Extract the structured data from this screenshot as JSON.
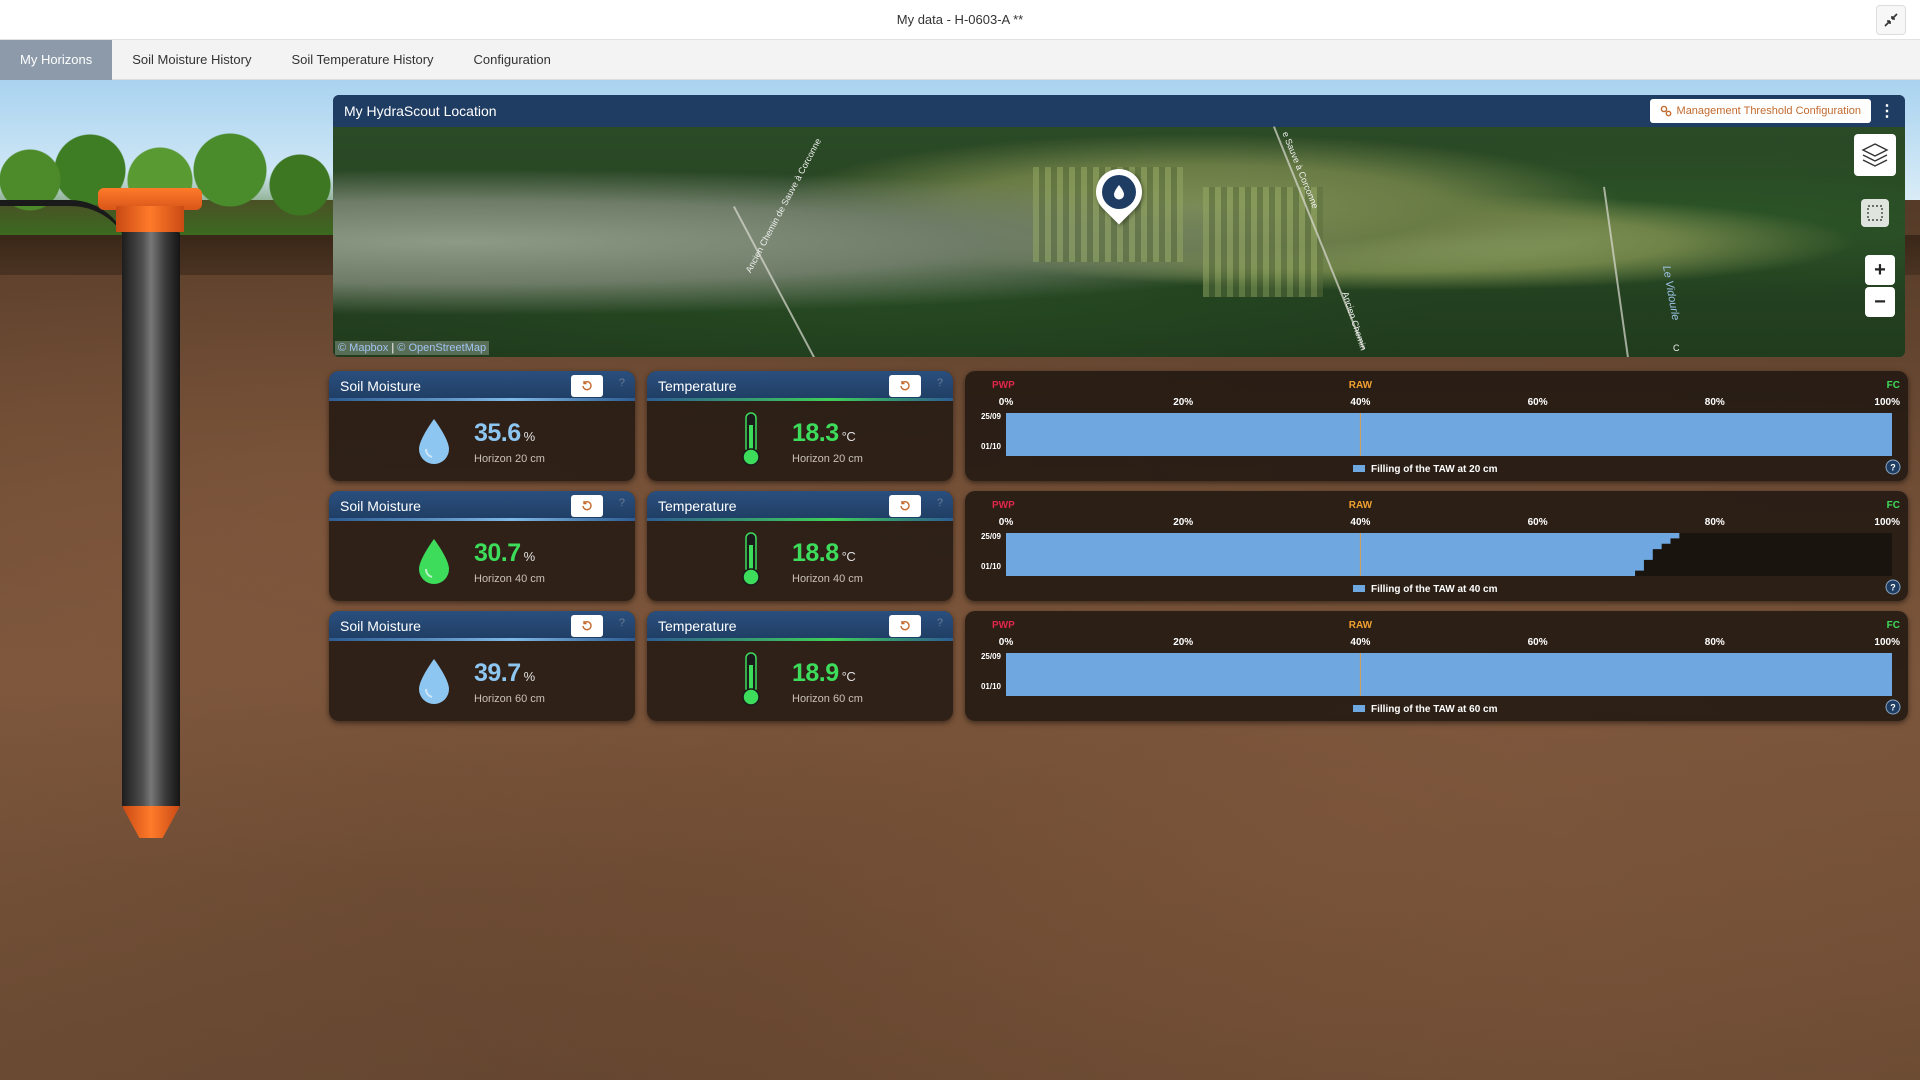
{
  "window": {
    "title": "My data - H-0603-A **",
    "collapse_icon": "compress-arrows-icon"
  },
  "tabs": [
    {
      "label": "My Horizons",
      "active": true
    },
    {
      "label": "Soil Moisture History",
      "active": false
    },
    {
      "label": "Soil Temperature History",
      "active": false
    },
    {
      "label": "Configuration",
      "active": false
    }
  ],
  "map": {
    "title": "My HydraScout Location",
    "management_button": "Management Threshold Configuration",
    "attribution_mapbox": "© Mapbox",
    "attribution_separator": "|",
    "attribution_osm": "© OpenStreetMap",
    "zoom_in": "+",
    "zoom_out": "−",
    "road_labels": [
      "Ancien Chemin de Sauve à Corconne",
      "e Sauve à Corconne",
      "Ancien Chemin",
      "C"
    ],
    "river_label": "Le Vidourle"
  },
  "rows": [
    {
      "moisture": {
        "title": "Soil Moisture",
        "value": "35.6",
        "unit": "%",
        "horizon": "Horizon 20 cm",
        "color": "#8ec6f2"
      },
      "temperature": {
        "title": "Temperature",
        "value": "18.3",
        "unit": "°C",
        "horizon": "Horizon 20 cm",
        "color": "#3ddc5a"
      },
      "taw_caption": "Filling of the TAW at 20 cm"
    },
    {
      "moisture": {
        "title": "Soil Moisture",
        "value": "30.7",
        "unit": "%",
        "horizon": "Horizon 40 cm",
        "color": "#3ddc5a"
      },
      "temperature": {
        "title": "Temperature",
        "value": "18.8",
        "unit": "°C",
        "horizon": "Horizon 40 cm",
        "color": "#3ddc5a"
      },
      "taw_caption": "Filling of the TAW at 40 cm"
    },
    {
      "moisture": {
        "title": "Soil Moisture",
        "value": "39.7",
        "unit": "%",
        "horizon": "Horizon 60 cm",
        "color": "#8ec6f2"
      },
      "temperature": {
        "title": "Temperature",
        "value": "18.9",
        "unit": "°C",
        "horizon": "Horizon 60 cm",
        "color": "#3ddc5a"
      },
      "taw_caption": "Filling of the TAW at 60 cm"
    }
  ],
  "chart_data": [
    {
      "type": "area",
      "orientation": "horizontal",
      "caption": "Filling of the TAW at 20 cm",
      "legend_label": "Filling of the TAW at 20 cm",
      "x_ticks": [
        "0%",
        "20%",
        "40%",
        "60%",
        "80%",
        "100%"
      ],
      "xlim": [
        0,
        100
      ],
      "y_ticks": [
        "25/09",
        "01/10"
      ],
      "thresholds": [
        {
          "label": "PWP",
          "value": 0,
          "color": "#e0264a"
        },
        {
          "label": "RAW",
          "value": 40,
          "color": "#f0a030"
        },
        {
          "label": "FC",
          "value": 100,
          "color": "#3ddc5a"
        }
      ],
      "series": [
        {
          "values": [
            100,
            100,
            100,
            100,
            100,
            100,
            100,
            100
          ]
        }
      ],
      "color": "#6fa8e0"
    },
    {
      "type": "area",
      "orientation": "horizontal",
      "caption": "Filling of the TAW at 40 cm",
      "legend_label": "Filling of the TAW at 40 cm",
      "x_ticks": [
        "0%",
        "20%",
        "40%",
        "60%",
        "80%",
        "100%"
      ],
      "xlim": [
        0,
        100
      ],
      "y_ticks": [
        "25/09",
        "01/10"
      ],
      "thresholds": [
        {
          "label": "PWP",
          "value": 0,
          "color": "#e0264a"
        },
        {
          "label": "RAW",
          "value": 40,
          "color": "#f0a030"
        },
        {
          "label": "FC",
          "value": 100,
          "color": "#3ddc5a"
        }
      ],
      "series": [
        {
          "values": [
            76,
            75,
            74,
            73,
            73,
            72,
            72,
            71
          ]
        }
      ],
      "color": "#6fa8e0"
    },
    {
      "type": "area",
      "orientation": "horizontal",
      "caption": "Filling of the TAW at 60 cm",
      "legend_label": "Filling of the TAW at 60 cm",
      "x_ticks": [
        "0%",
        "20%",
        "40%",
        "60%",
        "80%",
        "100%"
      ],
      "xlim": [
        0,
        100
      ],
      "y_ticks": [
        "25/09",
        "01/10"
      ],
      "thresholds": [
        {
          "label": "PWP",
          "value": 0,
          "color": "#e0264a"
        },
        {
          "label": "RAW",
          "value": 40,
          "color": "#f0a030"
        },
        {
          "label": "FC",
          "value": 100,
          "color": "#3ddc5a"
        }
      ],
      "series": [
        {
          "values": [
            100,
            100,
            100,
            100,
            100,
            100,
            100,
            100
          ]
        }
      ],
      "color": "#6fa8e0"
    }
  ]
}
